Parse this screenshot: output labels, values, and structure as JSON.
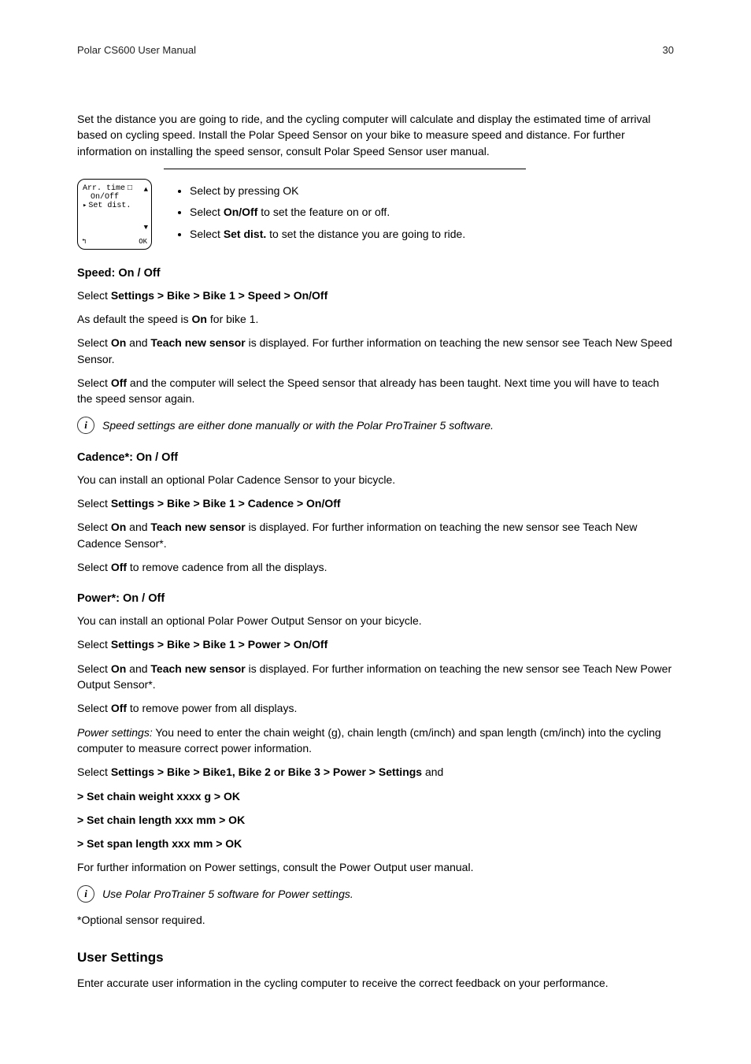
{
  "header": {
    "title": "Polar CS600 User Manual",
    "page": "30"
  },
  "intro": "Set the distance you are going to ride, and the cycling computer will calculate and display the estimated time of arrival based on cycling speed. Install the Polar Speed Sensor on your bike to measure speed and distance. For further information on installing the speed sensor, consult Polar Speed Sensor user manual.",
  "device": {
    "l1": "Arr. time",
    "l2": "On/Off",
    "l3": "Set dist.",
    "ok": "OK"
  },
  "bullets": {
    "b1": "Select by pressing OK",
    "b2a": "Select ",
    "b2b": "On/Off",
    "b2c": " to set the feature on or off.",
    "b3a": "Select ",
    "b3b": "Set dist.",
    "b3c": " to set the distance you are going to ride."
  },
  "speed": {
    "heading": "Speed: On / Off",
    "sel_a": "Select ",
    "sel_b": "Settings > Bike > Bike 1 > Speed > On/Off",
    "def_a": "As default the speed is ",
    "def_b": "On",
    "def_c": " for bike 1.",
    "on_a": "Select ",
    "on_b": "On",
    "on_c": " and ",
    "on_d": "Teach new sensor",
    "on_e": " is displayed. For further information on teaching the new sensor see Teach New Speed Sensor.",
    "off_a": "Select ",
    "off_b": "Off",
    "off_c": " and the computer will select the Speed sensor that already has been taught. Next time you will have to teach the speed sensor again.",
    "info": "Speed settings are either done manually or with the Polar ProTrainer 5 software."
  },
  "cadence": {
    "heading": "Cadence*: On / Off",
    "intro": "You can install an optional Polar Cadence Sensor to your bicycle.",
    "sel_a": "Select ",
    "sel_b": "Settings > Bike > Bike 1 > Cadence > On/Off",
    "on_a": "Select ",
    "on_b": "On",
    "on_c": " and ",
    "on_d": "Teach new sensor",
    "on_e": " is displayed. For further information on teaching the new sensor see Teach New Cadence Sensor*.",
    "off_a": "Select ",
    "off_b": "Off",
    "off_c": " to remove cadence from all the displays."
  },
  "power": {
    "heading": "Power*: On / Off",
    "intro": "You can install an optional Polar Power Output Sensor on your bicycle.",
    "sel_a": "Select ",
    "sel_b": "Settings > Bike > Bike 1 > Power > On/Off",
    "on_a": "Select ",
    "on_b": "On",
    "on_c": " and ",
    "on_d": "Teach new sensor",
    "on_e": " is displayed. For further information on teaching the new sensor see Teach New Power Output Sensor*.",
    "off_a": "Select ",
    "off_b": "Off",
    "off_c": " to remove power from all displays.",
    "ps_label": "Power settings:",
    "ps_text": " You need to enter the chain weight (g), chain length (cm/inch) and span length (cm/inch) into the cycling computer to measure correct power information.",
    "sel2_a": "Select ",
    "sel2_b": "Settings > Bike > Bike1, Bike 2 or Bike 3 > Power > Settings",
    "sel2_c": " and",
    "step1": "> Set chain weight xxxx g > OK",
    "step2": "> Set chain length xxx mm > OK",
    "step3": "> Set span length xxx mm > OK",
    "more": "For further information on Power settings, consult the Power Output user manual.",
    "info": "Use Polar ProTrainer 5 software for Power settings.",
    "note": "*Optional sensor required."
  },
  "user": {
    "heading": "User Settings",
    "text": "Enter accurate user information in the cycling computer to receive the correct feedback on your performance."
  }
}
